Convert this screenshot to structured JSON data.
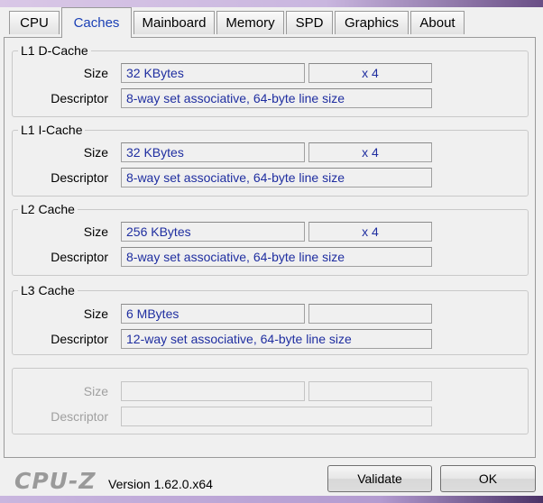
{
  "tabs": [
    {
      "label": "CPU",
      "active": false
    },
    {
      "label": "Caches",
      "active": true
    },
    {
      "label": "Mainboard",
      "active": false
    },
    {
      "label": "Memory",
      "active": false
    },
    {
      "label": "SPD",
      "active": false
    },
    {
      "label": "Graphics",
      "active": false
    },
    {
      "label": "About",
      "active": false
    }
  ],
  "labels": {
    "size": "Size",
    "descriptor": "Descriptor"
  },
  "groups": [
    {
      "title": "L1 D-Cache",
      "size": "32 KBytes",
      "count": "x 4",
      "descriptor": "8-way set associative, 64-byte line size"
    },
    {
      "title": "L1 I-Cache",
      "size": "32 KBytes",
      "count": "x 4",
      "descriptor": "8-way set associative, 64-byte line size"
    },
    {
      "title": "L2 Cache",
      "size": "256 KBytes",
      "count": "x 4",
      "descriptor": "8-way set associative, 64-byte line size"
    },
    {
      "title": "L3 Cache",
      "size": "6 MBytes",
      "count": "",
      "descriptor": "12-way set associative, 64-byte line size"
    },
    {
      "title": "",
      "size": "",
      "count": "",
      "descriptor": ""
    }
  ],
  "footer": {
    "logo": "CPU-Z",
    "version": "Version 1.62.0.x64",
    "validate_label": "Validate",
    "ok_label": "OK"
  },
  "colors": {
    "active_tab_text": "#1a3fb5",
    "value_text": "#1f2ea0",
    "disabled_text": "#a0a0a0"
  }
}
